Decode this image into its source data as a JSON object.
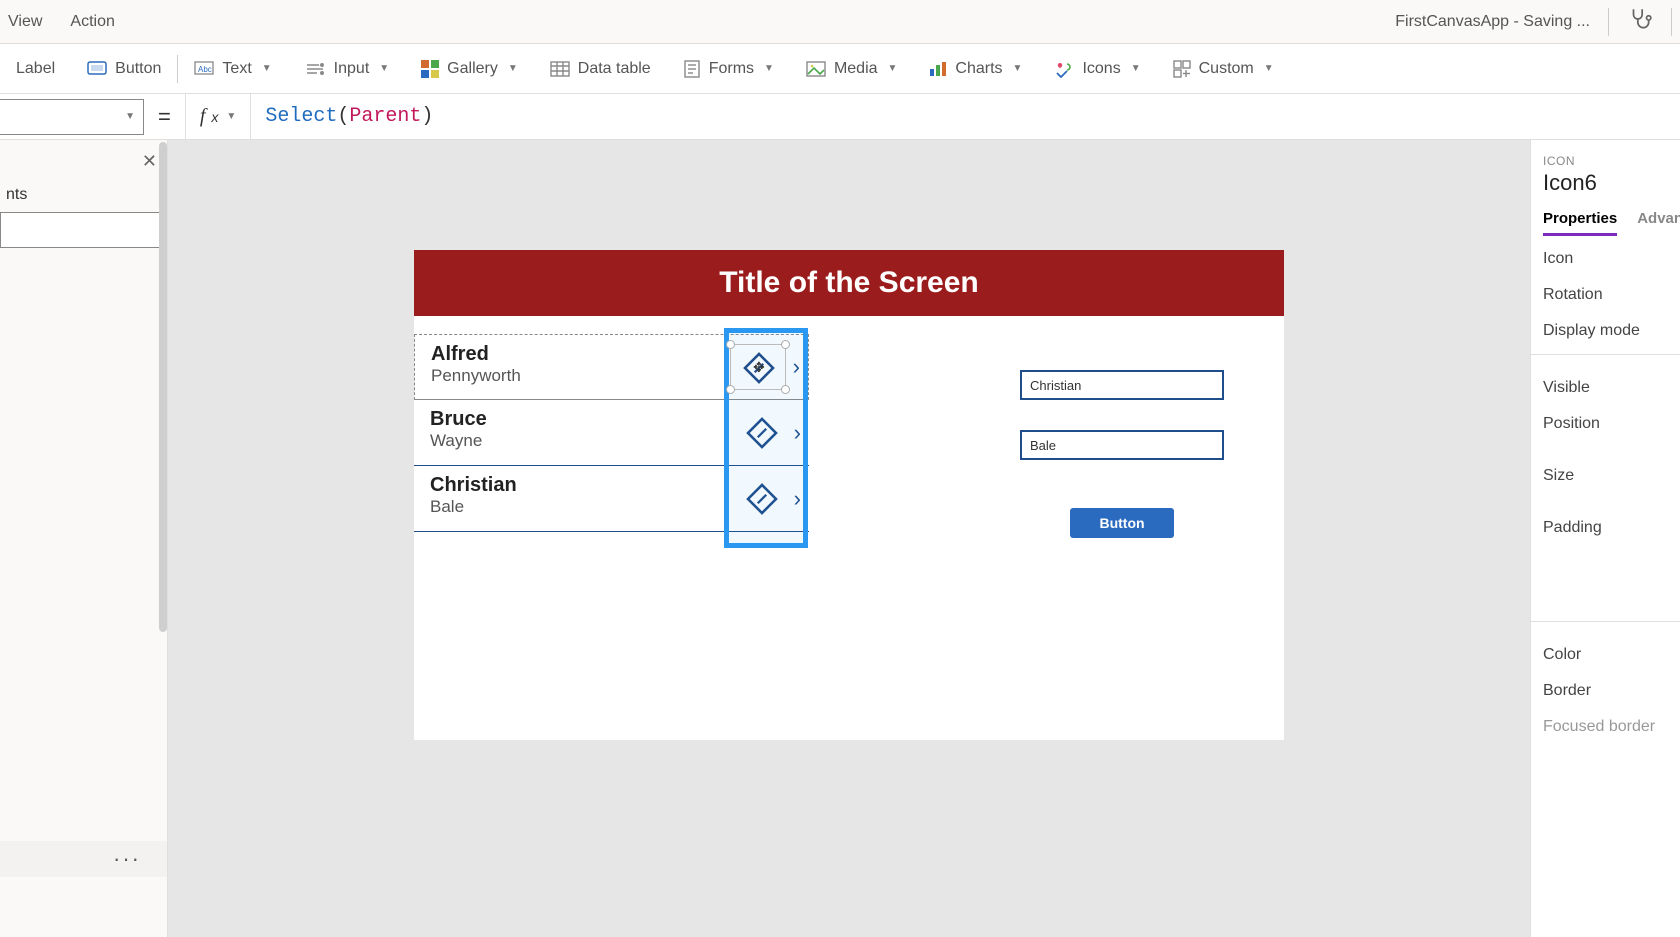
{
  "menu": {
    "view": "View",
    "action": "Action"
  },
  "header": {
    "app_status": "FirstCanvasApp - Saving ..."
  },
  "ribbon": {
    "label": "Label",
    "button": "Button",
    "text": "Text",
    "input": "Input",
    "gallery": "Gallery",
    "data_table": "Data table",
    "forms": "Forms",
    "media": "Media",
    "charts": "Charts",
    "icons": "Icons",
    "custom": "Custom"
  },
  "formula": {
    "fn": "Select",
    "arg": "Parent"
  },
  "left": {
    "section_suffix": "nts"
  },
  "canvas": {
    "title": "Title of the Screen",
    "gallery": [
      {
        "first": "Alfred",
        "last": "Pennyworth"
      },
      {
        "first": "Bruce",
        "last": "Wayne"
      },
      {
        "first": "Christian",
        "last": "Bale"
      }
    ],
    "input1": "Christian",
    "input2": "Bale",
    "button": "Button"
  },
  "right": {
    "type": "ICON",
    "name": "Icon6",
    "tab_properties": "Properties",
    "tab_advanced": "Advan",
    "rows": {
      "icon": "Icon",
      "rotation": "Rotation",
      "display_mode": "Display mode",
      "visible": "Visible",
      "position": "Position",
      "size": "Size",
      "padding": "Padding",
      "color": "Color",
      "border": "Border",
      "focused_border": "Focused border"
    }
  }
}
